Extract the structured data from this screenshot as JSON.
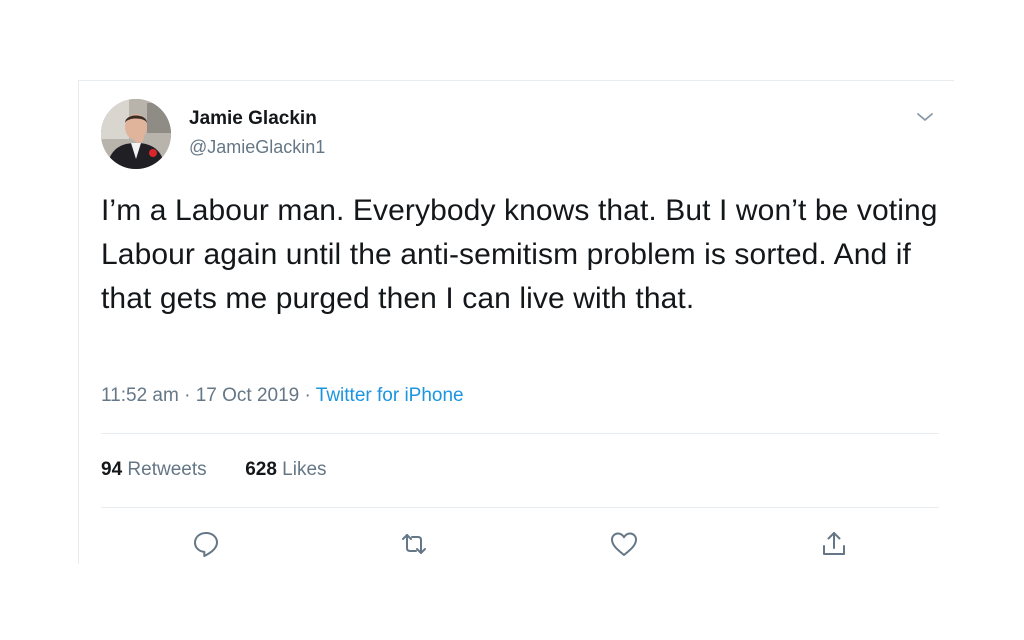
{
  "author": {
    "name": "Jamie Glackin",
    "handle": "@JamieGlackin1"
  },
  "menu_icon": "chevron-down-icon",
  "tweet": {
    "text": "I’m a Labour man. Everybody knows that. But I won’t be voting Labour again until the anti-semitism problem is sorted. And if that gets me purged then I can live with that."
  },
  "meta": {
    "time": "11:52 am",
    "separator": "·",
    "date": "17 Oct 2019",
    "source": "Twitter for iPhone"
  },
  "stats": {
    "retweets_count": "94",
    "retweets_label": "Retweets",
    "likes_count": "628",
    "likes_label": "Likes"
  },
  "actions": [
    "reply-icon",
    "retweet-icon",
    "like-icon",
    "share-icon"
  ],
  "colors": {
    "text": "#14171a",
    "secondary": "#657786",
    "link": "#1b95e0",
    "divider": "#e6ecf0"
  }
}
